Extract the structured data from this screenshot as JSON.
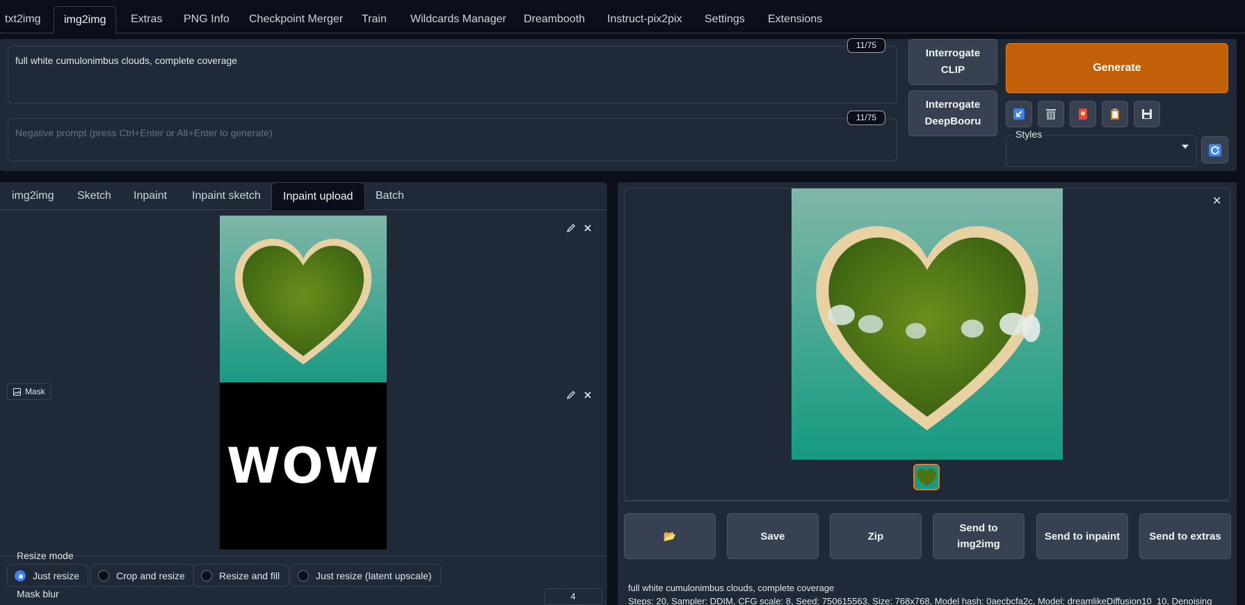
{
  "top_tabs": [
    "txt2img",
    "img2img",
    "Extras",
    "PNG Info",
    "Checkpoint Merger",
    "Train",
    "Wildcards Manager",
    "Dreambooth",
    "Instruct-pix2pix",
    "Settings",
    "Extensions"
  ],
  "active_top_tab": "img2img",
  "prompt": {
    "value": "full white cumulonimbus clouds, complete coverage",
    "token_count": "11/75"
  },
  "negative_prompt": {
    "placeholder": "Negative prompt (press Ctrl+Enter or Alt+Enter to generate)",
    "token_count": "11/75"
  },
  "buttons": {
    "interrogate_clip_1": "Interrogate",
    "interrogate_clip_2": "CLIP",
    "interrogate_deepbooru_1": "Interrogate",
    "interrogate_deepbooru_2": "DeepBooru",
    "generate": "Generate"
  },
  "tool_icons": [
    "arrow-icon",
    "trash-icon",
    "card-icon",
    "clipboard-icon",
    "save-icon"
  ],
  "styles": {
    "label": "Styles",
    "value": ""
  },
  "sub_tabs": [
    "img2img",
    "Sketch",
    "Inpaint",
    "Inpaint sketch",
    "Inpaint upload",
    "Batch"
  ],
  "active_sub_tab": "Inpaint upload",
  "mask_label": "Mask",
  "mask_text": "WOW",
  "resize_mode": {
    "label": "Resize mode",
    "options": [
      "Just resize",
      "Crop and resize",
      "Resize and fill",
      "Just resize (latent upscale)"
    ],
    "selected": "Just resize"
  },
  "mask_blur": {
    "label": "Mask blur",
    "value": "4"
  },
  "actions": {
    "folder": "📂",
    "save": "Save",
    "zip": "Zip",
    "send_img2img_1": "Send to",
    "send_img2img_2": "img2img",
    "send_inpaint": "Send to inpaint",
    "send_extras": "Send to extras"
  },
  "output_info": {
    "line1": "full white cumulonimbus clouds, complete coverage",
    "line2": "Steps: 20, Sampler: DDIM, CFG scale: 8, Seed: 750615563, Size: 768x768, Model hash: 0aecbcfa2c, Model: dreamlikeDiffusion10_10, Denoising"
  },
  "colors": {
    "background": "#0b0f19",
    "panel": "#1f2937",
    "border": "#374151",
    "accent": "#c2600a",
    "radio_checked": "#3b82f6"
  }
}
